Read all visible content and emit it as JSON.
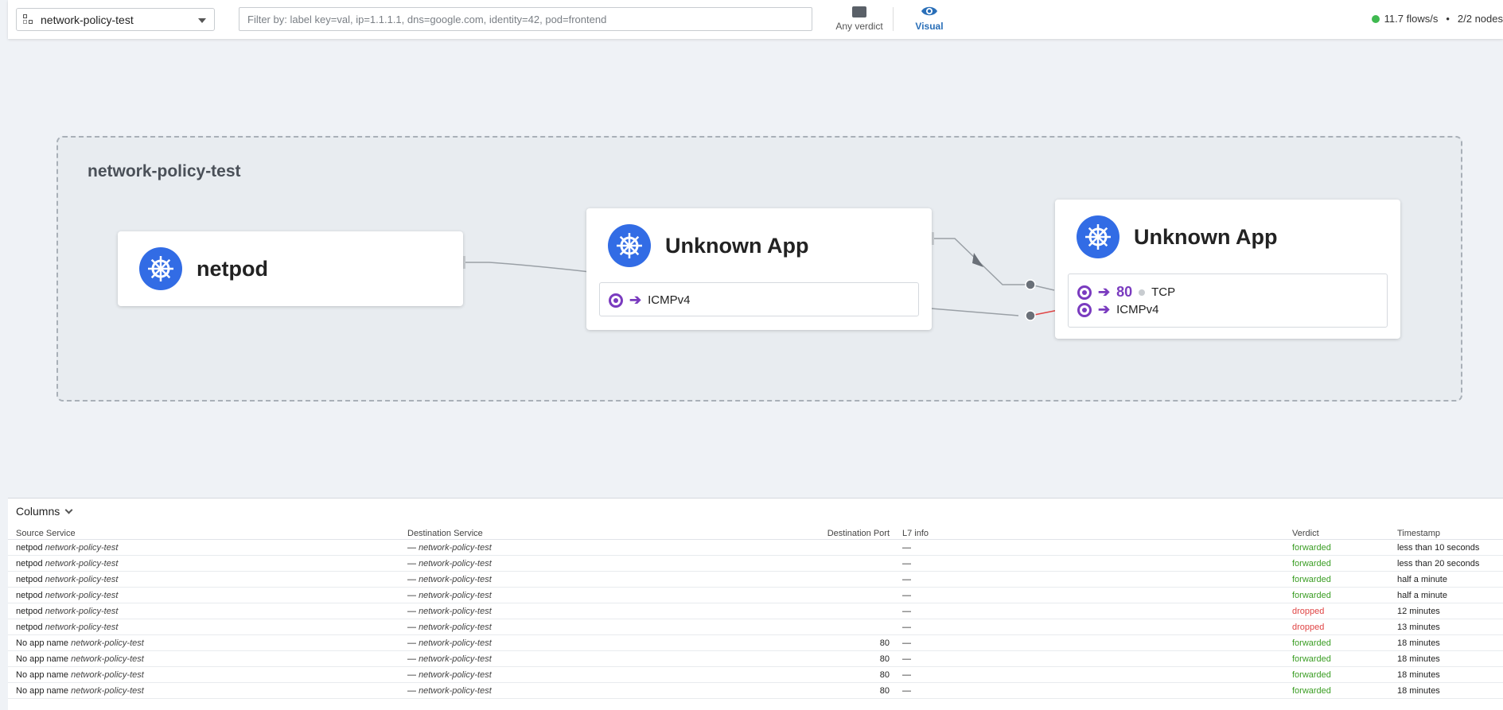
{
  "topbar": {
    "namespace": "network-policy-test",
    "filter_placeholder": "Filter by: label key=val, ip=1.1.1.1, dns=google.com, identity=42, pod=frontend",
    "verdict_label": "Any verdict",
    "visual_label": "Visual",
    "flows": "11.7 flows/s",
    "bullet": "•",
    "nodes": "2/2 nodes"
  },
  "map": {
    "namespace_title": "network-policy-test",
    "cards": [
      {
        "title": "netpod"
      },
      {
        "title": "Unknown App",
        "protocols": [
          {
            "label": "ICMPv4"
          }
        ]
      },
      {
        "title": "Unknown App",
        "protocols": [
          {
            "port": "80",
            "label": "TCP"
          },
          {
            "label": "ICMPv4"
          }
        ]
      }
    ]
  },
  "table": {
    "columns_label": "Columns",
    "headers": [
      "Source Service",
      "Destination Service",
      "Destination Port",
      "L7 info",
      "Verdict",
      "Timestamp"
    ],
    "rows": [
      {
        "src": "netpod",
        "src_ns": "network-policy-test",
        "dst": "—",
        "dst_ns": "network-policy-test",
        "port": "",
        "l7": "—",
        "verdict": "forwarded",
        "time": "less than 10 seconds"
      },
      {
        "src": "netpod",
        "src_ns": "network-policy-test",
        "dst": "—",
        "dst_ns": "network-policy-test",
        "port": "",
        "l7": "—",
        "verdict": "forwarded",
        "time": "less than 20 seconds"
      },
      {
        "src": "netpod",
        "src_ns": "network-policy-test",
        "dst": "—",
        "dst_ns": "network-policy-test",
        "port": "",
        "l7": "—",
        "verdict": "forwarded",
        "time": "half a minute"
      },
      {
        "src": "netpod",
        "src_ns": "network-policy-test",
        "dst": "—",
        "dst_ns": "network-policy-test",
        "port": "",
        "l7": "—",
        "verdict": "forwarded",
        "time": "half a minute"
      },
      {
        "src": "netpod",
        "src_ns": "network-policy-test",
        "dst": "—",
        "dst_ns": "network-policy-test",
        "port": "",
        "l7": "—",
        "verdict": "dropped",
        "time": "12 minutes"
      },
      {
        "src": "netpod",
        "src_ns": "network-policy-test",
        "dst": "—",
        "dst_ns": "network-policy-test",
        "port": "",
        "l7": "—",
        "verdict": "dropped",
        "time": "13 minutes"
      },
      {
        "src": "No app name",
        "src_ns": "network-policy-test",
        "dst": "—",
        "dst_ns": "network-policy-test",
        "port": "80",
        "l7": "—",
        "verdict": "forwarded",
        "time": "18 minutes"
      },
      {
        "src": "No app name",
        "src_ns": "network-policy-test",
        "dst": "—",
        "dst_ns": "network-policy-test",
        "port": "80",
        "l7": "—",
        "verdict": "forwarded",
        "time": "18 minutes"
      },
      {
        "src": "No app name",
        "src_ns": "network-policy-test",
        "dst": "—",
        "dst_ns": "network-policy-test",
        "port": "80",
        "l7": "—",
        "verdict": "forwarded",
        "time": "18 minutes"
      },
      {
        "src": "No app name",
        "src_ns": "network-policy-test",
        "dst": "—",
        "dst_ns": "network-policy-test",
        "port": "80",
        "l7": "—",
        "verdict": "forwarded",
        "time": "18 minutes"
      }
    ]
  },
  "colors": {
    "accent": "#2a6fb8",
    "k8s_blue": "#326ce5",
    "protocol_purple": "#7a3bbf",
    "forwarded": "#3a9d23",
    "dropped": "#e04545",
    "status_green": "#3fb950"
  },
  "icons": [
    "namespace-icon",
    "dropdown-caret-icon",
    "verdict-icon",
    "eye-icon",
    "kubernetes-icon",
    "protocol-ring-icon",
    "arrow-right-icon",
    "chevron-down-icon"
  ]
}
